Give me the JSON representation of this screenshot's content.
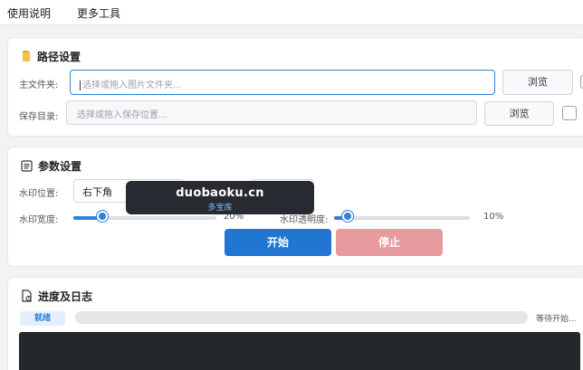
{
  "menu": {
    "instructions": "使用说明",
    "more_tools": "更多工具"
  },
  "path_settings": {
    "title": "路径设置",
    "icon": "folder-icon",
    "main_folder_label": "主文件夹:",
    "main_folder_placeholder": "选择或拖入图片文件夹...",
    "main_folder_browse": "浏览",
    "save_dir_label": "保存目录:",
    "save_dir_placeholder": "选择或拖入保存位置...",
    "save_dir_browse": "浏览"
  },
  "param_settings": {
    "title": "参数设置",
    "icon": "document-icon",
    "position_label": "水印位置:",
    "position_value": "右下角",
    "width_label": "水印宽度:",
    "width_value_text": "20%",
    "width_fraction": 0.2,
    "opacity_label": "水印透明度:",
    "opacity_value_text": "10%",
    "opacity_fraction": 0.1
  },
  "actions": {
    "start": "开始",
    "stop": "停止"
  },
  "watermark": {
    "line1": "duobaoku.cn",
    "line2": "多宝库"
  },
  "progress_log": {
    "title": "进度及日志",
    "icon": "log-icon",
    "status": "就绪",
    "progress_fraction": 0,
    "status_text": "等待开始..."
  },
  "colors": {
    "accent": "#2f80d8",
    "start_button": "#2176d2",
    "stop_button": "#e89b9f",
    "log_bg": "#24272c"
  }
}
